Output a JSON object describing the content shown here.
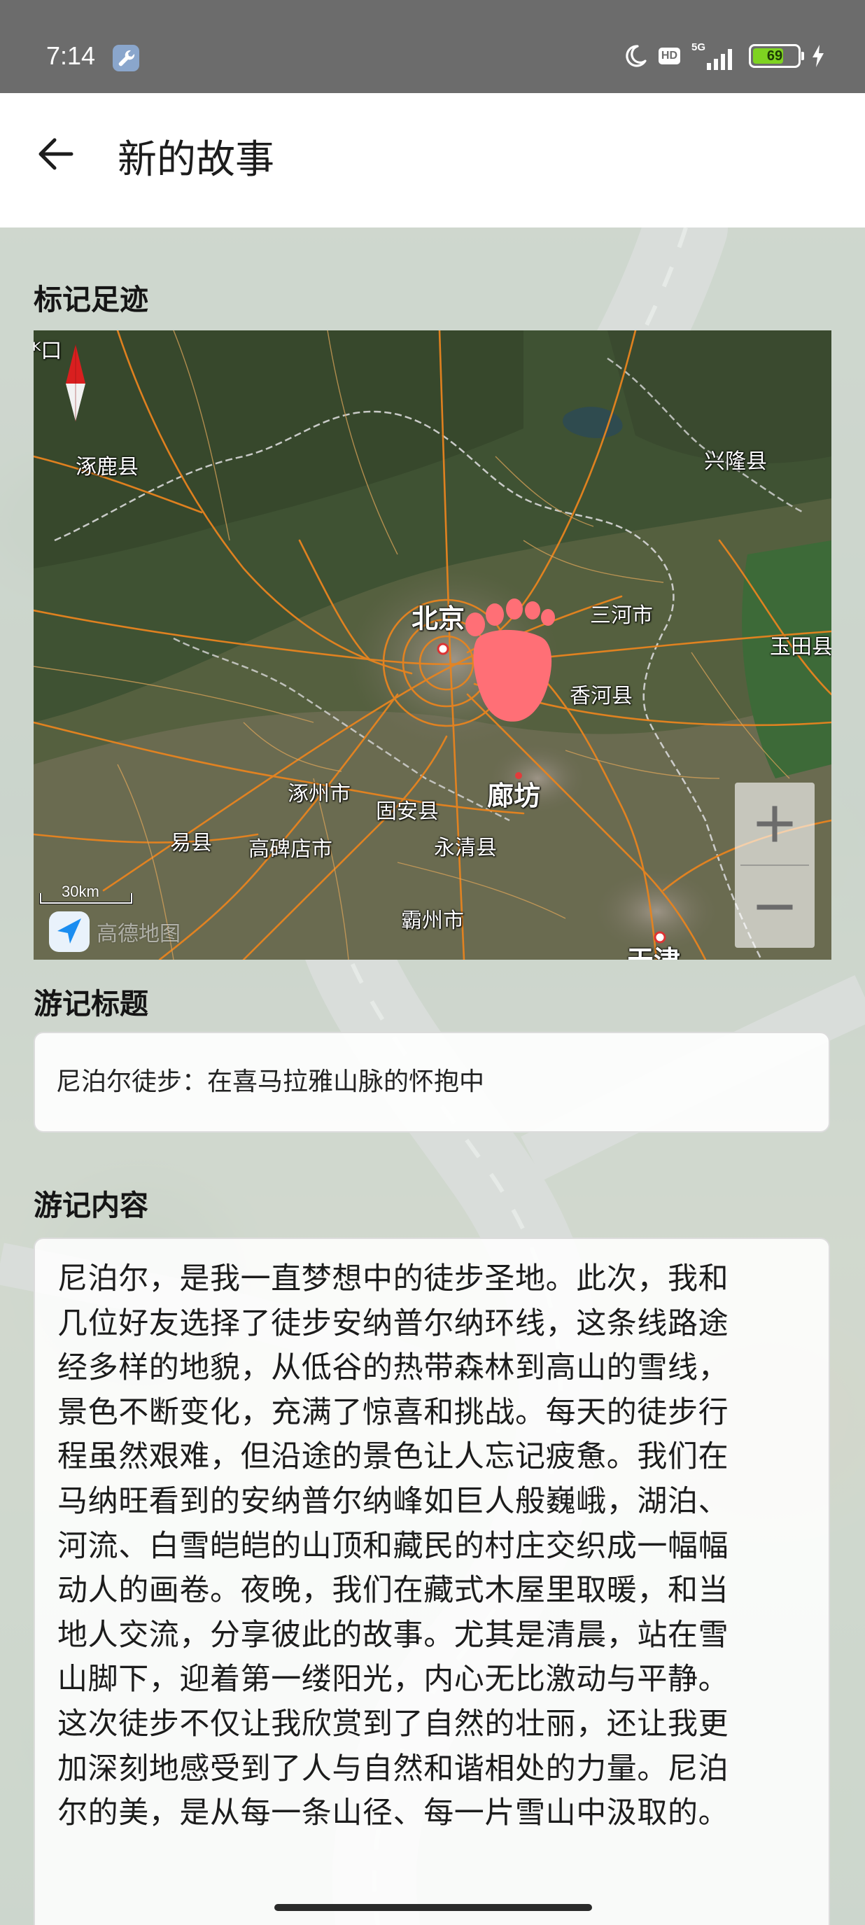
{
  "status_bar": {
    "time": "7:14",
    "app_icon": "wrench-icon",
    "dnd_icon": "moon-icon",
    "hd_badge": "HD",
    "network_type": "5G",
    "battery_level": "69",
    "battery_fraction": 0.69,
    "charging_icon": "bolt-icon"
  },
  "app_bar": {
    "back_icon": "arrow-left-icon",
    "title": "新的故事"
  },
  "map_section": {
    "label": "标记足迹",
    "places": {
      "zhuolu": "涿鹿县",
      "xinglong": "兴隆县",
      "beijing": "北京",
      "sanhe": "三河市",
      "yutian": "玉田县",
      "xianghe": "香河县",
      "zhuozhou": "涿州市",
      "gu_an": "固安县",
      "langfang": "廊坊",
      "yixian": "易县",
      "gaobeidian": "高碑店市",
      "yongqing": "永清县",
      "bazhou": "霸州市",
      "tianjin": "天津"
    },
    "scale": "30km",
    "logo": "高德地图",
    "zoom_in_label": "+",
    "zoom_out_label": "−",
    "marker_icon": "footprint-icon",
    "compass_icon": "compass-icon"
  },
  "title_section": {
    "label": "游记标题",
    "value": "尼泊尔徒步：在喜马拉雅山脉的怀抱中"
  },
  "content_section": {
    "label": "游记内容",
    "lines": [
      "尼泊尔，是我一直梦想中的徒步圣地。此次，我和",
      "几位好友选择了徒步安纳普尔纳环线，这条线路途",
      "经多样的地貌，从低谷的热带森林到高山的雪线，",
      "景色不断变化，充满了惊喜和挑战。每天的徒步行",
      "程虽然艰难，但沿途的景色让人忘记疲惫。我们在",
      "马纳旺看到的安纳普尔纳峰如巨人般巍峨，湖泊、",
      "河流、白雪皑皑的山顶和藏民的村庄交织成一幅幅",
      "动人的画卷。夜晚，我们在藏式木屋里取暖，和当",
      "地人交流，分享彼此的故事。尤其是清晨，站在雪",
      "山脚下，迎着第一缕阳光，内心无比激动与平静。",
      "这次徒步不仅让我欣赏到了自然的壮丽，还让我更",
      "加深刻地感受到了人与自然和谐相处的力量。尼泊",
      "尔的美，是从每一条山径、每一片雪山中汲取的。"
    ]
  }
}
